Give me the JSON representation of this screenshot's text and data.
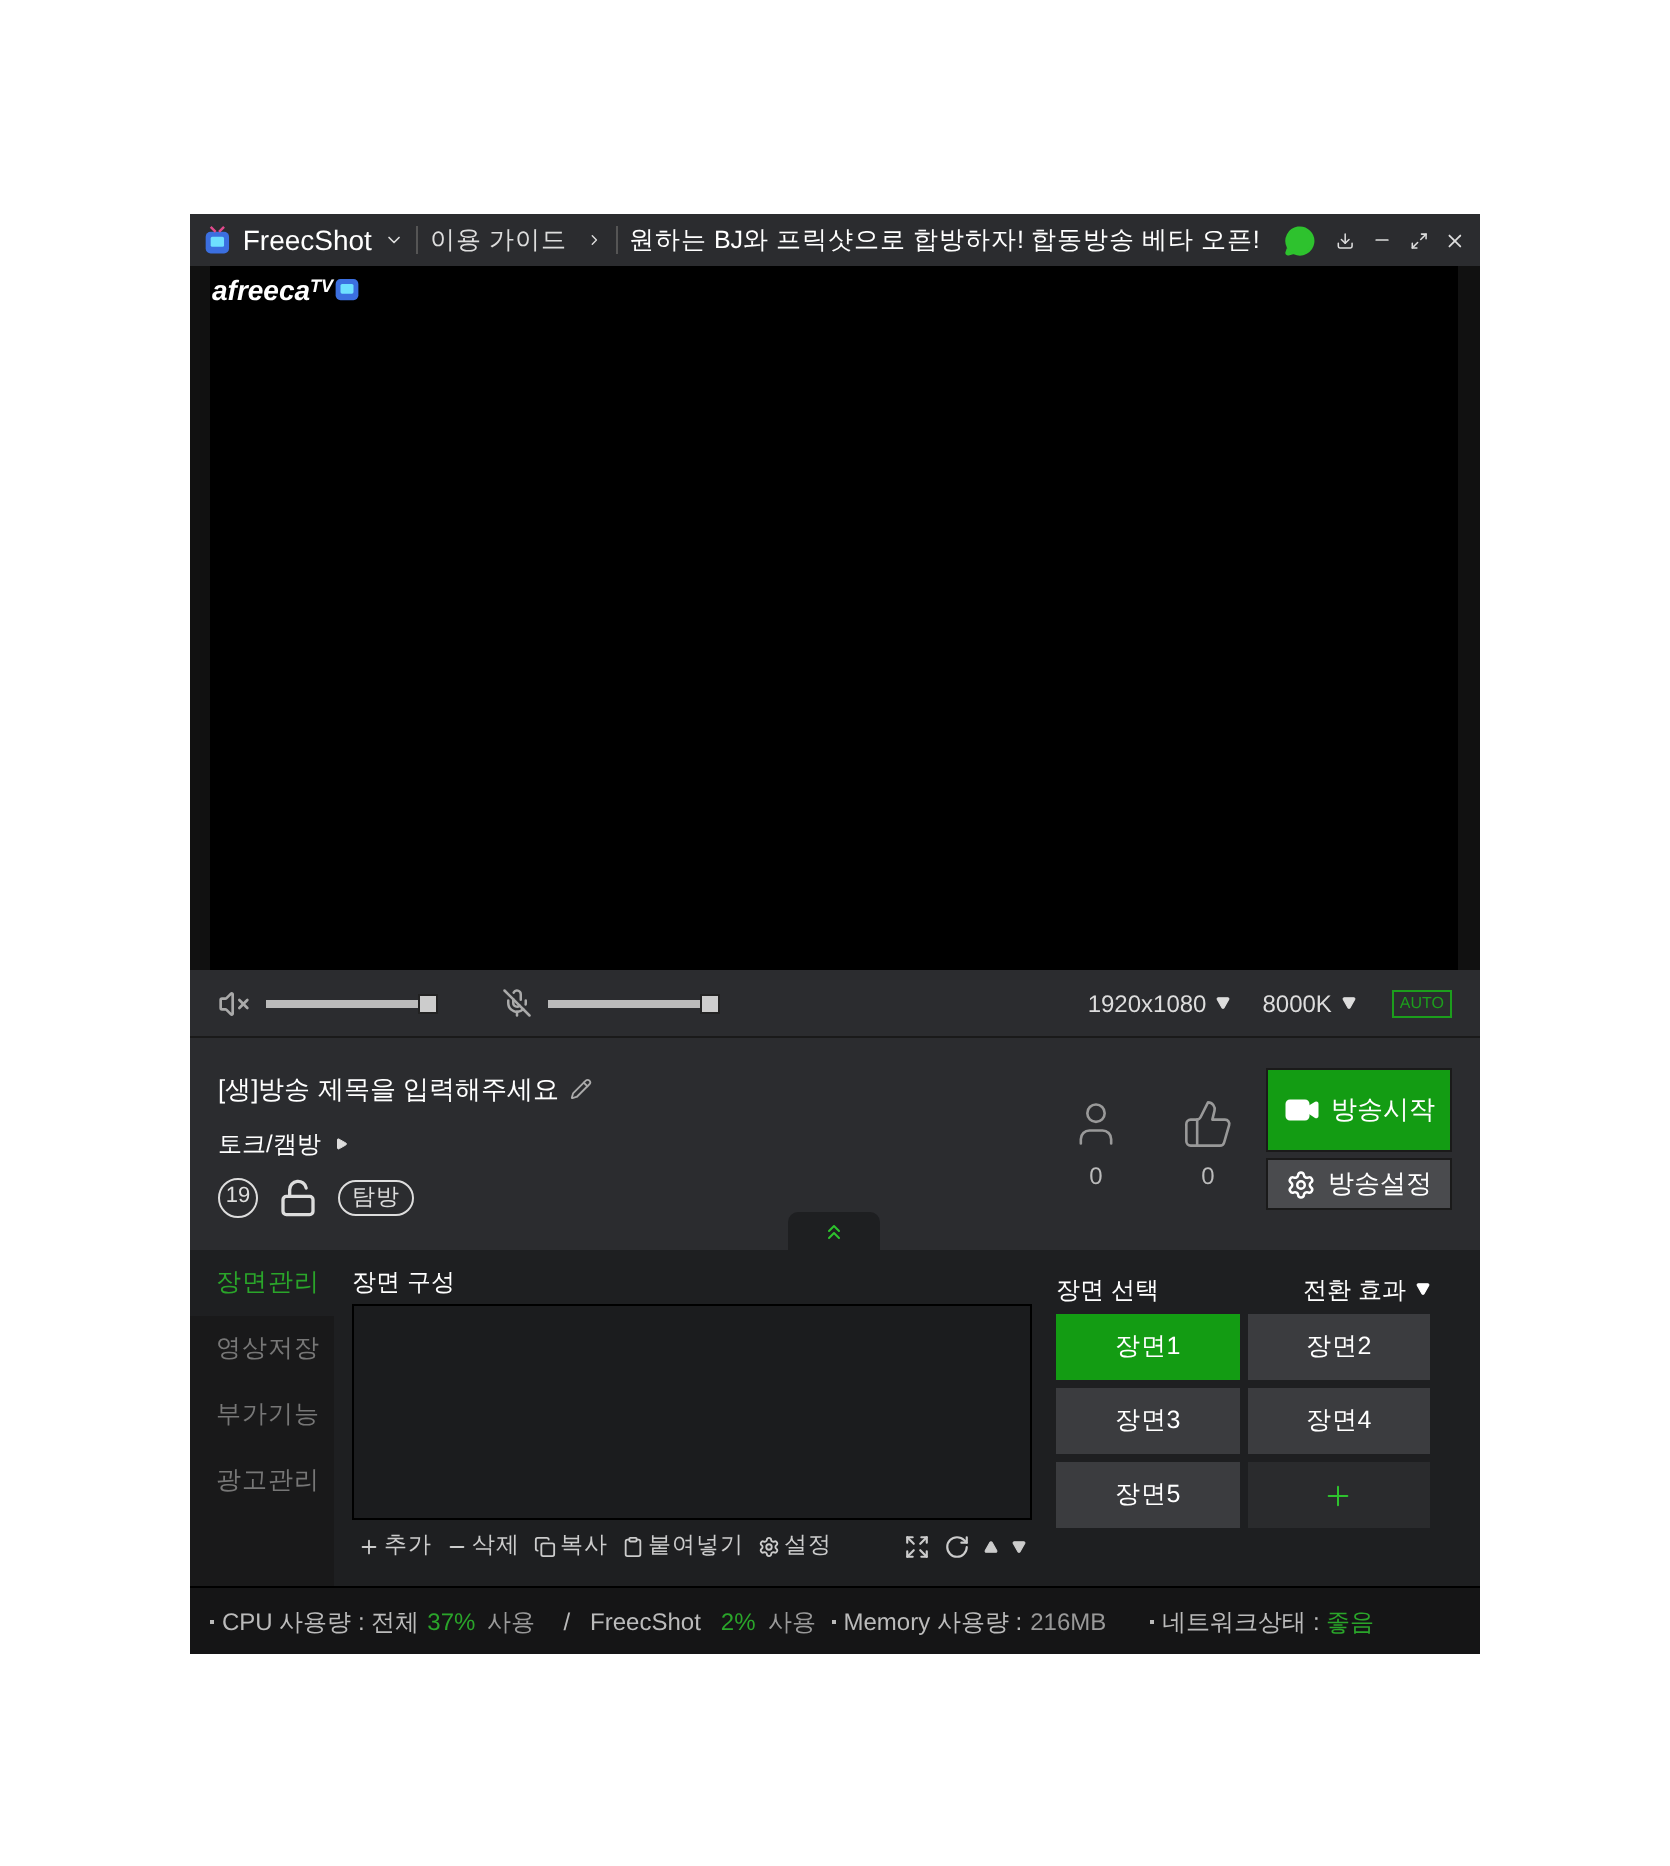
{
  "title_bar": {
    "app_name": "FreecShot",
    "guide_link": "이용 가이드",
    "marquee": "원하는 BJ와 프릭샷으로 합방하자! 합동방송 베타 오픈!"
  },
  "video": {
    "logo": "afreeca",
    "logo_suffix": "TV"
  },
  "controls": {
    "speaker": {
      "muted": true,
      "level": 1
    },
    "mic": {
      "muted": true,
      "level": 1
    },
    "resolution": "1920x1080",
    "bitrate": "8000K",
    "auto": "AUTO"
  },
  "broadcast": {
    "title": "[생]방송 제목을 입력해주세요",
    "category": "토크/캠방",
    "age_badge": "19",
    "locked": false,
    "tag": "탐방",
    "viewers": "0",
    "ups": "0",
    "start_button": "방송시작",
    "settings_button": "방송설정"
  },
  "side_tabs": [
    {
      "label": "장면관리",
      "selected": true
    },
    {
      "label": "영상저장",
      "selected": false
    },
    {
      "label": "부가기능",
      "selected": false
    },
    {
      "label": "광고관리",
      "selected": false
    }
  ],
  "scene_composition": {
    "title": "장면 구성",
    "tools": [
      {
        "kind": "add",
        "label": "추가"
      },
      {
        "kind": "delete",
        "label": "삭제"
      },
      {
        "kind": "copy",
        "label": "복사"
      },
      {
        "kind": "paste",
        "label": "붙여넣기"
      },
      {
        "kind": "settings",
        "label": "설정"
      }
    ]
  },
  "scene_select": {
    "title": "장면 선택",
    "transition": "전환 효과",
    "scenes": [
      {
        "label": "장면1",
        "selected": true
      },
      {
        "label": "장면2",
        "selected": false
      },
      {
        "label": "장면3",
        "selected": false
      },
      {
        "label": "장면4",
        "selected": false
      },
      {
        "label": "장면5",
        "selected": false
      }
    ]
  },
  "status_bar": {
    "cpu_label": "CPU 사용량 : 전체",
    "cpu_total": "37%",
    "cpu_unit": "사용",
    "separator": "/",
    "app": "FreecShot",
    "app_cpu": "2%",
    "app_unit": "사용",
    "memory_label": "Memory 사용량 :",
    "memory": "216MB",
    "network_label": "네트워크상태 :",
    "network": "좋음"
  }
}
